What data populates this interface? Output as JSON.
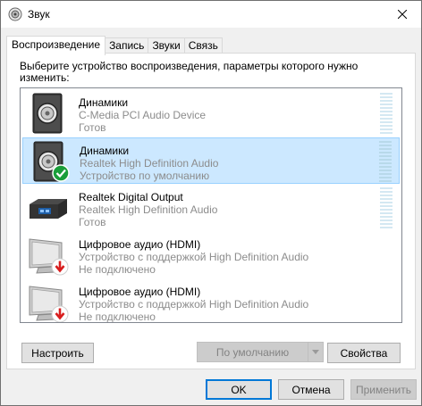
{
  "window": {
    "title": "Звук",
    "title_icon": "speaker-icon",
    "close_icon": "close-icon"
  },
  "tabs": [
    {
      "label": "Воспроизведение",
      "active": true
    },
    {
      "label": "Запись",
      "active": false
    },
    {
      "label": "Звуки",
      "active": false
    },
    {
      "label": "Связь",
      "active": false
    }
  ],
  "playback": {
    "instruction": "Выберите устройство воспроизведения, параметры которого нужно изменить:",
    "devices": [
      {
        "name": "Динамики",
        "line1": "C-Media PCI Audio Device",
        "line2": "Готов",
        "icon": "speaker-device-icon",
        "badge": "",
        "selected": false
      },
      {
        "name": "Динамики",
        "line1": "Realtek High Definition Audio",
        "line2": "Устройство по умолчанию",
        "icon": "speaker-device-icon",
        "badge": "default-check-icon",
        "selected": true
      },
      {
        "name": "Realtek Digital Output",
        "line1": "Realtek High Definition Audio",
        "line2": "Готов",
        "icon": "digital-output-icon",
        "badge": "",
        "selected": false
      },
      {
        "name": "Цифровое аудио (HDMI)",
        "line1": "Устройство с поддержкой High Definition Audio",
        "line2": "Не подключено",
        "icon": "monitor-icon",
        "badge": "disconnected-arrow-icon",
        "selected": false
      },
      {
        "name": "Цифровое аудио (HDMI)",
        "line1": "Устройство с поддержкой High Definition Audio",
        "line2": "Не подключено",
        "icon": "monitor-icon",
        "badge": "disconnected-arrow-icon",
        "selected": false
      }
    ]
  },
  "panel_buttons": {
    "configure": "Настроить",
    "set_default": "По умолчанию",
    "properties": "Свойства"
  },
  "dialog_buttons": {
    "ok": "OK",
    "cancel": "Отмена",
    "apply": "Применить"
  },
  "colors": {
    "selection": "#cce8ff",
    "selection_border": "#99d1ff",
    "default_badge": "#1a9e3a",
    "disconnected_badge": "#d81e1e",
    "accent": "#0078d7"
  }
}
